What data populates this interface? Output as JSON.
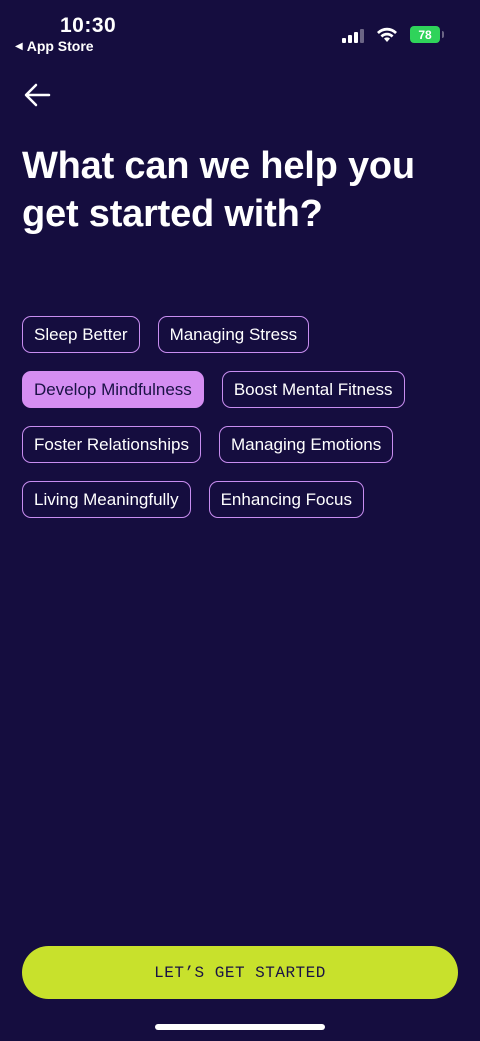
{
  "status_bar": {
    "time": "10:30",
    "back_app_label": "App Store",
    "battery_level": "78"
  },
  "header": {
    "title": "What can we help you get started with?"
  },
  "chips": [
    [
      {
        "label": "Sleep Better",
        "selected": false
      },
      {
        "label": "Managing Stress",
        "selected": false
      }
    ],
    [
      {
        "label": "Develop Mindfulness",
        "selected": true
      },
      {
        "label": "Boost Mental Fitness",
        "selected": false
      }
    ],
    [
      {
        "label": "Foster Relationships",
        "selected": false
      },
      {
        "label": "Managing Emotions",
        "selected": false
      }
    ],
    [
      {
        "label": "Living Meaningfully",
        "selected": false
      },
      {
        "label": "Enhancing Focus",
        "selected": false
      }
    ]
  ],
  "cta": {
    "label": "LET’S GET STARTED"
  },
  "colors": {
    "background": "#150d3f",
    "chip_border": "#c88df0",
    "chip_selected": "#d58ef2",
    "cta": "#c8e12c",
    "battery": "#2fd35a"
  }
}
